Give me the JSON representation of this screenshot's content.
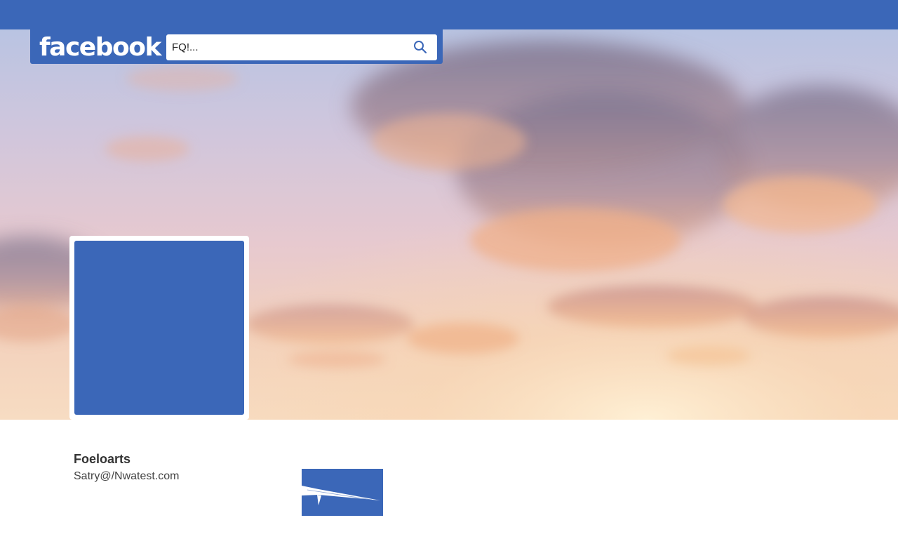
{
  "brand": {
    "logo_text": "facebook",
    "primary_color": "#3b67b8"
  },
  "search": {
    "value": "FQ!...",
    "icon": "search-icon"
  },
  "profile": {
    "name": "Foeloarts",
    "email": "Satry@/Nwatest.com",
    "picture_color": "#3b67b8"
  },
  "cover": {
    "description_icon": "sunset-clouds-image"
  },
  "thumbnail": {
    "icon": "quill-icon"
  }
}
